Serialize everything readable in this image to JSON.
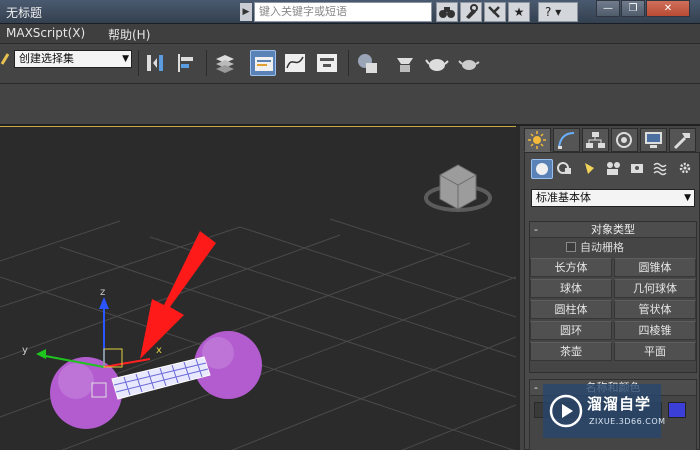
{
  "window": {
    "title": "无标题",
    "search_placeholder": "键入关键字或短语",
    "help_label": "?"
  },
  "menubar": {
    "items": [
      "MAXScript(X)",
      "帮助(H)"
    ]
  },
  "toolbar": {
    "selection_set_value": "创建选择集"
  },
  "command_panel": {
    "category_value": "标准基本体",
    "object_type_rollout": {
      "title": "对象类型",
      "collapse_symbol": "-",
      "autogrid_label": "自动栅格",
      "buttons": [
        "长方体",
        "圆锥体",
        "球体",
        "几何球体",
        "圆柱体",
        "管状体",
        "圆环",
        "四棱锥",
        "茶壶",
        "平面"
      ]
    },
    "name_color_rollout": {
      "title": "名称和颜色",
      "collapse_symbol": "-",
      "color": "#3b3fd8"
    }
  },
  "viewport": {
    "gizmo_labels": [
      "x",
      "y",
      "z"
    ]
  },
  "watermark": {
    "title": "溜溜自学",
    "subtitle": "ZIXUE.3D66.COM"
  },
  "colors": {
    "accent_active": "#5b82b6",
    "viewport_border": "#c8a746",
    "sphere": "#b25ccf",
    "arrow": "#ff1a1a"
  }
}
